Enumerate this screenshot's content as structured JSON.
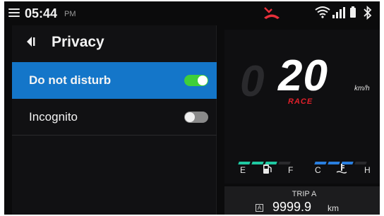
{
  "status_bar": {
    "time": "05:44",
    "ampm": "PM",
    "icons": [
      "menu-icon",
      "missed-call-icon",
      "wifi-icon",
      "signal-icon",
      "battery-icon",
      "bluetooth-icon"
    ]
  },
  "privacy_panel": {
    "title": "Privacy",
    "settings": [
      {
        "label": "Do not disturb",
        "enabled": true,
        "highlighted": true
      },
      {
        "label": "Incognito",
        "enabled": false,
        "highlighted": false
      }
    ]
  },
  "cluster": {
    "speed": "20",
    "speed_ghost": "0",
    "speed_unit": "km/h",
    "mode": "RACE",
    "fuel_gauge": {
      "low_label": "E",
      "high_label": "F",
      "level_segments": 3,
      "total_segments": 4,
      "icon": "fuel-pump-icon"
    },
    "temp_gauge": {
      "low_label": "C",
      "high_label": "H",
      "level_segments": 3,
      "total_segments": 4,
      "icon": "coolant-temp-icon"
    }
  },
  "trip": {
    "label": "TRIP A",
    "badge": "A",
    "value": "9999.9",
    "unit": "km"
  },
  "colors": {
    "accent_blue": "#1476c9",
    "toggle_on": "#3fcf3a",
    "toggle_off": "#8a8a8a",
    "mode_red": "#e0202a",
    "missed_call_red": "#e8303a",
    "fuel_green": "#1fc9a2",
    "temp_blue": "#2a7fe0"
  }
}
